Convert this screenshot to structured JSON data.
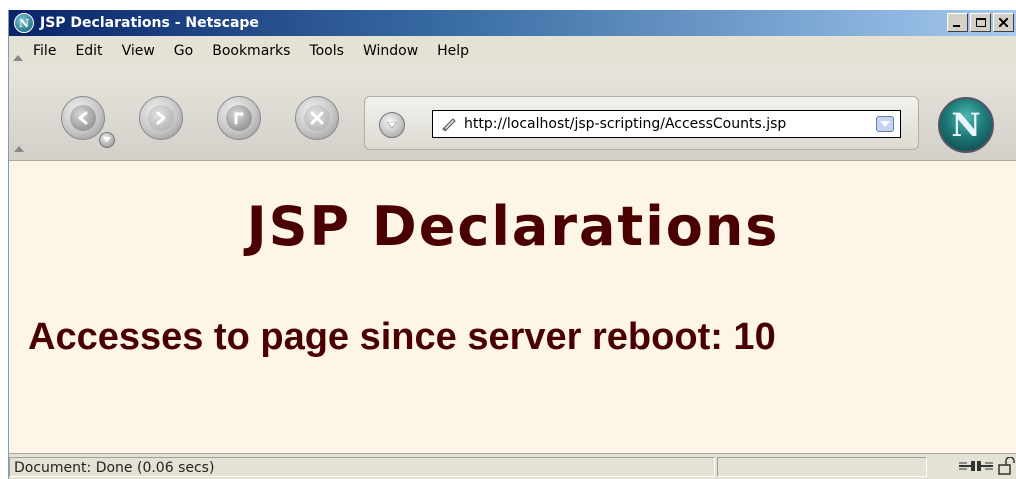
{
  "window": {
    "title": "JSP Declarations - Netscape",
    "app_icon": "netscape-n-icon",
    "controls": {
      "minimize": "_",
      "maximize": "□",
      "close": "✕"
    }
  },
  "menubar": {
    "items": [
      {
        "label": "File"
      },
      {
        "label": "Edit"
      },
      {
        "label": "View"
      },
      {
        "label": "Go"
      },
      {
        "label": "Bookmarks"
      },
      {
        "label": "Tools"
      },
      {
        "label": "Window"
      },
      {
        "label": "Help"
      }
    ]
  },
  "toolbar": {
    "buttons": [
      "back-icon",
      "forward-icon",
      "reload-icon",
      "stop-icon"
    ],
    "url": "http://localhost/jsp-scripting/AccessCounts.jsp",
    "throbber_letter": "N"
  },
  "content": {
    "heading": "JSP Declarations",
    "access_text": "Accesses to page since server reboot: 10"
  },
  "status": {
    "text": "Document: Done (0.06 secs)"
  },
  "colors": {
    "content_bg": "#fdf5e6",
    "heading_color": "#4a0000",
    "titlebar_start": "#0a246a"
  }
}
